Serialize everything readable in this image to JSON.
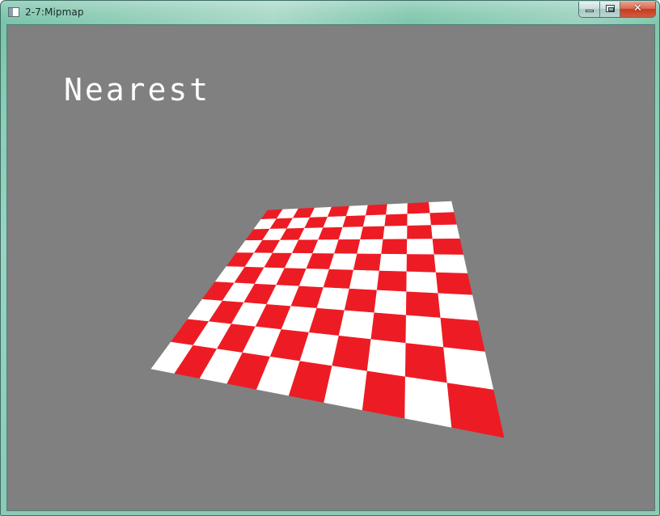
{
  "window": {
    "title": "2-7:Mipmap",
    "close_symbol": "✕",
    "icons": [
      "app-window-icon",
      "minimize-icon",
      "maximize-icon",
      "close-icon"
    ]
  },
  "viewport": {
    "background_color": "#808080",
    "filter_label": "Nearest",
    "texture": {
      "pattern": "checkerboard",
      "color_a": "#ed1c24",
      "color_b": "#ffffff",
      "grid_cells": 10
    }
  }
}
